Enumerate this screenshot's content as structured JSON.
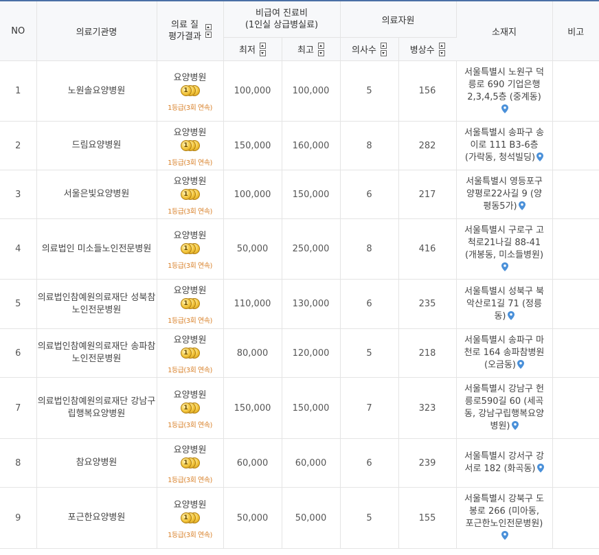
{
  "headers": {
    "no": "NO",
    "name": "의료기관명",
    "quality_line1": "의료 질",
    "quality_line2": "평가결과",
    "fee_line1": "비급여 진료비",
    "fee_line2": "(1인실 상급병실료)",
    "fee_min": "최저",
    "fee_max": "최고",
    "staff": "의료자원",
    "doctors": "의사수",
    "beds": "병상수",
    "address": "소재지",
    "remarks": "비고"
  },
  "quality_type": "요양병원",
  "quality_grade": "1등급(3회 연속)",
  "medal_digit": "1",
  "icons": {
    "sort": "sort-updown-icon",
    "medal": "medal-icon",
    "pin": "map-pin-icon"
  },
  "colors": {
    "header_border": "#4a6fa5",
    "grade": "#d9822b",
    "pin": "#4a90d9",
    "medal": "#f3c53a"
  },
  "rows": [
    {
      "no": "1",
      "name": "노원솔요양병원",
      "fee_min": "100,000",
      "fee_max": "100,000",
      "doctors": "5",
      "beds": "156",
      "address": "서울특별시 노원구 덕릉로 690 기업은행 2,3,4,5층 (중계동)",
      "remarks": ""
    },
    {
      "no": "2",
      "name": "드림요양병원",
      "fee_min": "150,000",
      "fee_max": "160,000",
      "doctors": "8",
      "beds": "282",
      "address": "서울특별시 송파구 송이로 111 B3-6층 (가락동, 청석빌딩)",
      "remarks": ""
    },
    {
      "no": "3",
      "name": "서울은빛요양병원",
      "fee_min": "100,000",
      "fee_max": "150,000",
      "doctors": "6",
      "beds": "217",
      "address": "서울특별시 영등포구 양평로22사길 9 (양평동5가)",
      "remarks": ""
    },
    {
      "no": "4",
      "name": "의료법인 미소들노인전문병원",
      "fee_min": "50,000",
      "fee_max": "250,000",
      "doctors": "8",
      "beds": "416",
      "address": "서울특별시 구로구 고척로21나길 88-41 (개봉동, 미소들병원)",
      "remarks": ""
    },
    {
      "no": "5",
      "name": "의료법인참예원의료재단 성북참노인전문병원",
      "fee_min": "110,000",
      "fee_max": "130,000",
      "doctors": "6",
      "beds": "235",
      "address": "서울특별시 성북구 북악산로1길 71 (정릉동)",
      "remarks": ""
    },
    {
      "no": "6",
      "name": "의료법인참예원의료재단 송파참노인전문병원",
      "fee_min": "80,000",
      "fee_max": "120,000",
      "doctors": "5",
      "beds": "218",
      "address": "서울특별시 송파구 마천로 164 송파참병원 (오금동)",
      "remarks": ""
    },
    {
      "no": "7",
      "name": "의료법인참예원의료재단 강남구립행복요양병원",
      "fee_min": "150,000",
      "fee_max": "150,000",
      "doctors": "7",
      "beds": "323",
      "address": "서울특별시 강남구 헌릉로590길 60 (세곡동, 강남구립행복요양병원)",
      "remarks": ""
    },
    {
      "no": "8",
      "name": "참요양병원",
      "fee_min": "60,000",
      "fee_max": "60,000",
      "doctors": "6",
      "beds": "239",
      "address": "서울특별시 강서구 강서로 182 (화곡동)",
      "remarks": ""
    },
    {
      "no": "9",
      "name": "포근한요양병원",
      "fee_min": "50,000",
      "fee_max": "50,000",
      "doctors": "5",
      "beds": "155",
      "address": "서울특별시 강북구 도봉로 266 (미아동, 포근한노인전문병원)",
      "remarks": ""
    }
  ]
}
